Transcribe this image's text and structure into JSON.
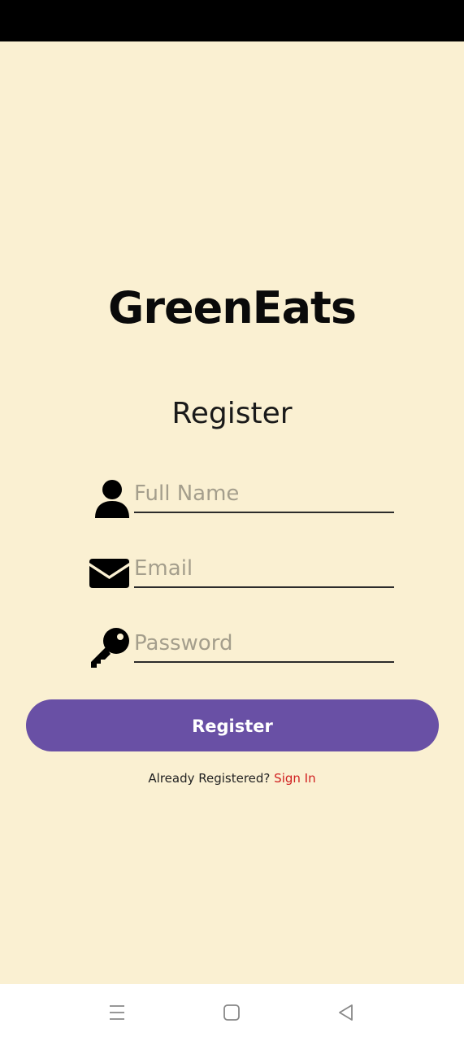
{
  "app": {
    "title": "GreenEats"
  },
  "form": {
    "heading": "Register",
    "fields": [
      {
        "name": "full-name",
        "placeholder": "Full Name",
        "value": "",
        "icon": "person-icon"
      },
      {
        "name": "email",
        "placeholder": "Email",
        "value": "",
        "icon": "envelope-icon"
      },
      {
        "name": "password",
        "placeholder": "Password",
        "value": "",
        "icon": "key-icon"
      }
    ],
    "submit_label": "Register",
    "signin_prompt": "Already Registered?",
    "signin_link": "Sign In"
  },
  "nav": {
    "buttons": [
      "menu-icon",
      "home-icon",
      "back-icon"
    ]
  },
  "colors": {
    "background": "#FAF0D2",
    "button": "#6950A5",
    "link": "#D02020",
    "status_bar": "#000000"
  }
}
